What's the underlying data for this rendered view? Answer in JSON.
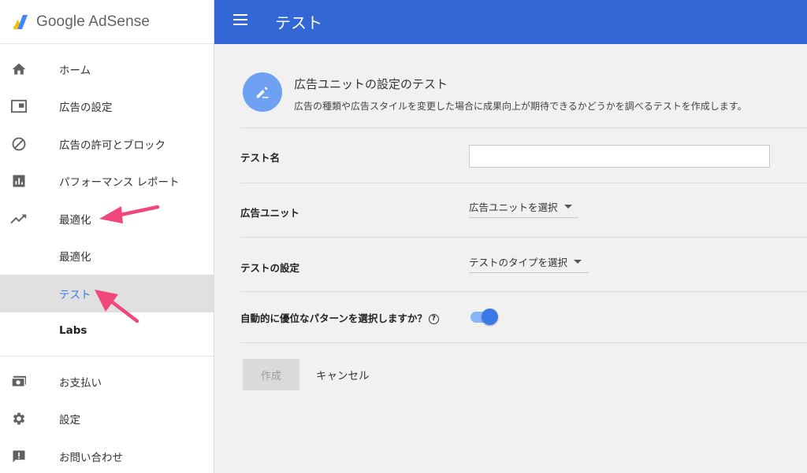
{
  "brand": {
    "name": "Google AdSense",
    "logo_colors": [
      "#fbbc04",
      "#4285f4"
    ]
  },
  "sidebar": {
    "items": [
      {
        "label": "ホーム",
        "icon": "home-icon"
      },
      {
        "label": "広告の設定",
        "icon": "ad-settings-icon"
      },
      {
        "label": "広告の許可とブロック",
        "icon": "block-icon"
      },
      {
        "label": "パフォーマンス レポート",
        "icon": "bar-chart-icon"
      },
      {
        "label": "最適化",
        "icon": "trending-up-icon"
      },
      {
        "label": "最適化",
        "icon": ""
      },
      {
        "label": "テスト",
        "icon": "",
        "active": true
      },
      {
        "label": "Labs",
        "icon": ""
      }
    ],
    "bottom_items": [
      {
        "label": "お支払い",
        "icon": "payments-icon"
      },
      {
        "label": "設定",
        "icon": "gear-icon"
      },
      {
        "label": "お問い合わせ",
        "icon": "feedback-icon"
      }
    ]
  },
  "topbar": {
    "title": "テスト",
    "accent": "#3367d6"
  },
  "header": {
    "title": "広告ユニットの設定のテスト",
    "description": "広告の種類や広告スタイルを変更した場合に成果向上が期待できるかどうかを調べるテストを作成します。"
  },
  "form": {
    "test_name_label": "テスト名",
    "test_name_value": "",
    "ad_unit_label": "広告ユニット",
    "ad_unit_value": "広告ユニットを選択",
    "test_settings_label": "テストの設定",
    "test_settings_value": "テストのタイプを選択",
    "auto_select_label": "自動的に優位なパターンを選択しますか？",
    "auto_select_help": "?",
    "auto_select_on": true
  },
  "buttons": {
    "create": "作成",
    "cancel": "キャンセル"
  },
  "annotation_color": "#f0467a"
}
